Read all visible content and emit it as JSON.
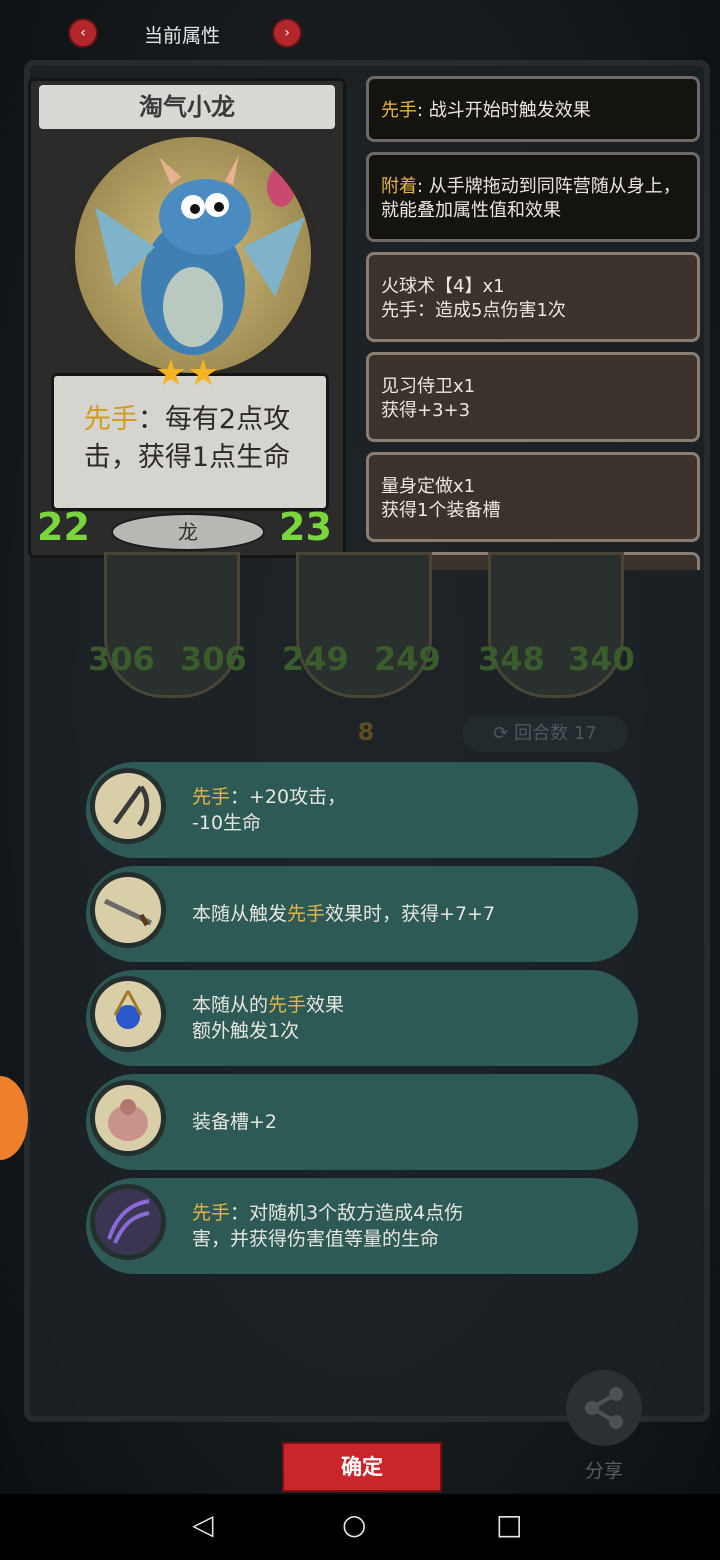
{
  "header": {
    "title": "当前属性",
    "prev_icon": "chevron-left-icon",
    "next_icon": "chevron-right-icon"
  },
  "card": {
    "name": "淘气小龙",
    "stars": "★★",
    "ability_prefix": "先手",
    "ability_rest": "：每有2点攻击，获得1点生命",
    "attack": "22",
    "health": "23",
    "tribe": "龙"
  },
  "keywords": [
    {
      "label": "先手",
      "text": ": 战斗开始时触发效果"
    },
    {
      "label": "附着",
      "text": ": 从手牌拖动到同阵营随从身上，就能叠加属性值和效果"
    }
  ],
  "buffs": [
    {
      "line1": "火球术【4】x1",
      "line2": "先手：造成5点伤害1次"
    },
    {
      "line1": "见习侍卫x1",
      "line2": "获得+3+3"
    },
    {
      "line1": "量身定做x1",
      "line2": "获得1个装备槽"
    }
  ],
  "board": {
    "stats": [
      "306",
      "306",
      "249",
      "249",
      "348",
      "340"
    ],
    "tier": "8",
    "round_label": "回合数",
    "round_value": "17"
  },
  "equipment": [
    {
      "icon": "scythe-icon",
      "pre": "",
      "hl": "先手",
      "post": "：+20攻击，",
      "line2": "-10生命"
    },
    {
      "icon": "sword-icon",
      "pre": "本随从触发",
      "hl": "先手",
      "post": "效果时，获得+7+7",
      "line2": ""
    },
    {
      "icon": "orb-icon",
      "pre": "本随从的",
      "hl": "先手",
      "post": "效果",
      "line2": "额外触发1次"
    },
    {
      "icon": "backpack-icon",
      "pre": "装备槽+2",
      "hl": "",
      "post": "",
      "line2": ""
    },
    {
      "icon": "claw-icon",
      "pre": "",
      "hl": "先手",
      "post": "：对随机3个敌方造成4点伤",
      "line2": "害，并获得伤害值等量的生命"
    }
  ],
  "actions": {
    "confirm": "确定",
    "share": "分享"
  },
  "colors": {
    "accent_red": "#c8262a",
    "highlight": "#e4b64a",
    "equip_bg": "#2e5a55",
    "stat_green": "#79d63d"
  }
}
